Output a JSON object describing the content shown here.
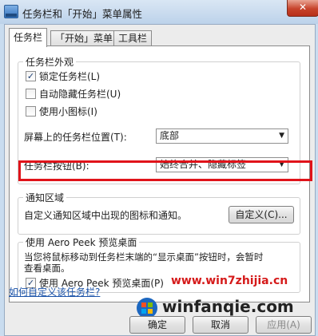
{
  "window": {
    "title": "任务栏和「开始」菜单属性",
    "close_glyph": "✕"
  },
  "tabs": [
    "任务栏",
    "「开始」菜单",
    "工具栏"
  ],
  "appearance": {
    "title": "任务栏外观",
    "lock_label": "锁定任务栏(L)",
    "lock_checked": true,
    "autohide_label": "自动隐藏任务栏(U)",
    "autohide_checked": false,
    "small_icons_label": "使用小图标(I)",
    "small_icons_checked": false,
    "position_label": "屏幕上的任务栏位置(T):",
    "position_value": "底部",
    "buttons_label": "任务栏按钮(B):",
    "buttons_value": "始终合并、隐藏标签"
  },
  "notify": {
    "title": "通知区域",
    "desc": "自定义通知区域中出现的图标和通知。",
    "customize_button": "自定义(C)..."
  },
  "peek": {
    "title": "使用 Aero Peek 预览桌面",
    "desc_line1": "当您将鼠标移动到任务栏末端的“显示桌面”按钮时，会暂时",
    "desc_line2": "查看桌面。",
    "checkbox_label": "使用 Aero Peek 预览桌面(P)",
    "checked": true
  },
  "help_link": "如何自定义该任务栏?",
  "buttons": {
    "ok": "确定",
    "cancel": "取消",
    "apply": "应用(A)"
  },
  "watermark": {
    "url": "www.win7zhijia.cn",
    "brand": "winfanqie.com"
  },
  "colors": {
    "highlight": "#e0131a",
    "watermark": "#d51a1a"
  }
}
